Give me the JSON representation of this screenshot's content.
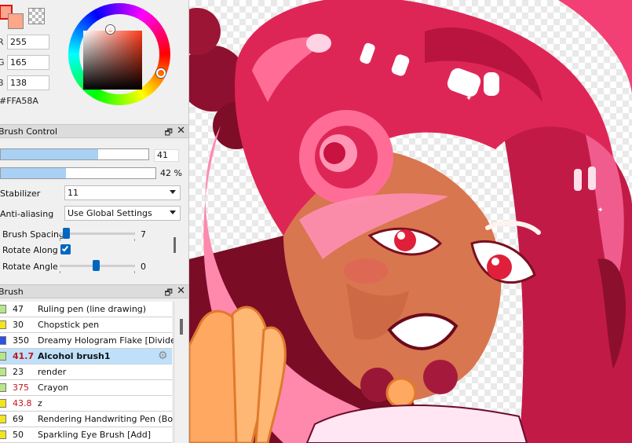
{
  "color": {
    "rgb_labels": [
      "R",
      "G",
      "B"
    ],
    "r": "255",
    "g": "165",
    "b": "138",
    "hex": "#FFA58A",
    "main": "#FFA58A",
    "sub": "#FFA58A"
  },
  "brush_control": {
    "title": "Brush Control",
    "size_value": "41",
    "size_fraction": 0.66,
    "opacity_label": "42 %",
    "opacity_fraction": 0.42,
    "stabilizer_label": "Stabilizer",
    "stabilizer_value": "11",
    "antialias_label": "Anti-aliasing",
    "antialias_value": "Use Global Settings",
    "spacing_label": "Brush Spacing",
    "spacing_value": "7",
    "rotate_along_label": "Rotate Along",
    "rotate_along_checked": true,
    "rotate_angle_label": "Rotate Angle",
    "rotate_angle_value": "0"
  },
  "brush_panel": {
    "title": "Brush",
    "items": [
      {
        "size": "47",
        "name": "Ruling pen (line drawing)",
        "chip": "#b7e58a",
        "red": false,
        "selected": false
      },
      {
        "size": "30",
        "name": "Chopstick pen",
        "chip": "#f2e51c",
        "red": false,
        "selected": false
      },
      {
        "size": "350",
        "name": "Dreamy Hologram Flake [Divide]",
        "chip": "#3050e6",
        "red": false,
        "selected": false
      },
      {
        "size": "41.7",
        "name": "Alcohol brush1",
        "chip": "#b7e58a",
        "red": true,
        "selected": true
      },
      {
        "size": "23",
        "name": "render",
        "chip": "#b7e58a",
        "red": false,
        "selected": false
      },
      {
        "size": "375",
        "name": "Crayon",
        "chip": "#b7e58a",
        "red": true,
        "selected": false
      },
      {
        "size": "43.8",
        "name": "z",
        "chip": "#f2e51c",
        "red": true,
        "selected": false
      },
      {
        "size": "69",
        "name": "Rendering Handwriting Pen (Bold",
        "chip": "#f2e51c",
        "red": false,
        "selected": false
      },
      {
        "size": "50",
        "name": "Sparkling Eye Brush [Add]",
        "chip": "#f2e51c",
        "red": false,
        "selected": false
      }
    ]
  },
  "icons": {
    "float": "float-panel-icon",
    "close": "close-icon",
    "gear": "gear-icon"
  }
}
